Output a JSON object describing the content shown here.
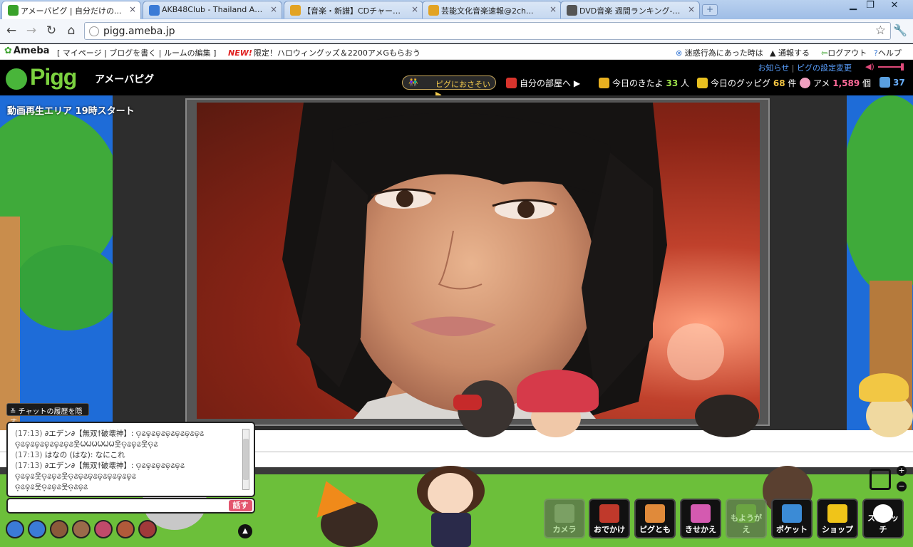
{
  "browser": {
    "tabs": [
      {
        "title": "アメーバピグ | 自分だけの...",
        "favicon_color": "#3aa22b",
        "active": true
      },
      {
        "title": "AKB48Club - Thailand AKB4...",
        "favicon_color": "#3b7bd6",
        "active": false
      },
      {
        "title": "【音楽・新譜】CDチャート速...",
        "favicon_color": "#e2a324",
        "active": false
      },
      {
        "title": "芸能文化音楽速報@2ch...",
        "favicon_color": "#e2a324",
        "active": false
      },
      {
        "title": "DVD音楽 週間ランキング-O...",
        "favicon_color": "#555555",
        "active": false
      }
    ],
    "close_glyph": "×",
    "new_tab_glyph": "+",
    "window_buttons": {
      "minimize": "▁",
      "restore": "❐",
      "close": "✕"
    },
    "toolbar": {
      "back": "←",
      "forward": "→",
      "reload": "↻",
      "home": "⌂",
      "star": "☆",
      "wrench": "🔧"
    },
    "url": "pigg.ameba.jp"
  },
  "ameba_bar": {
    "logo": "Ameba",
    "links": "[ マイページ | ブログを書く | ルームの編集 ]",
    "new_badge": "NEW!",
    "promo": "限定！ハロウィングッズ＆2200アメGもらおう",
    "report_trouble": "迷惑行為にあった時は",
    "report": "通報する",
    "logout": "ログアウト",
    "help": "ヘルプ"
  },
  "pigg_header": {
    "logo": "Pigg",
    "subtitle": "アメーバピグ",
    "notice": "お知らせ",
    "settings": "ピグの設定変更",
    "invite_button": "ピグにおさそい",
    "my_room": "自分の部屋へ",
    "visitors_label": "今日のきたよ",
    "visitors_count": "33",
    "visitors_unit": "人",
    "goods_label": "今日のグッピグ",
    "goods_count": "68",
    "goods_unit": "件",
    "ame_label": "アメ",
    "ame_count": "1,589",
    "ame_unit": "個",
    "coins": "37"
  },
  "game": {
    "area_label": "動画再生エリア 19時スタート"
  },
  "chat": {
    "hide_history": "チャットの履歴を隠す",
    "messages": [
      {
        "time": "(17:13)",
        "text": "∂エデン∂【無双†破壊神】: ଡ଼ଌଢ଼ଌଢ଼ଌଢ଼ଌଢ଼ଌଢ଼ଌଢ଼ଌ"
      },
      {
        "time": "",
        "text": "ଡ଼ଌଢ଼ଌଢ଼ଌଢ଼ଌଢ଼ଌଢ଼ଌ웃ᱦᱦᱦᱦᱦᱦ웃ଡ଼ଌଢ଼ଌ웃ଡ଼ଌ"
      },
      {
        "time": "(17:13)",
        "text": "はなの (はな): なにこれ"
      },
      {
        "time": "(17:13)",
        "text": "∂エデン∂【無双†破壊神】: ଡ଼ଌଢ଼ଌଢ଼ଌଢ଼ଌଢ଼ଌ"
      },
      {
        "time": "",
        "text": "ଡ଼ଌଢ଼ଌ웃ଡ଼ଌଢ଼ଌ웃ଡ଼ଌଢ଼ଌଢ଼ଌଢ଼ଌଢ଼ଌଢ଼ଌଢ଼ଌ"
      },
      {
        "time": "",
        "text": "ଡ଼ଌଢ଼ଌ웃ଡ଼ଌଢ଼ଌ웃ଡ଼ଌଢ଼ଌ"
      }
    ],
    "input_placeholder": "",
    "say_button": "話す",
    "up_arrow": "▲"
  },
  "menu": [
    {
      "label": "カメラ",
      "name": "camera-button",
      "color": "#888888",
      "disabled": true
    },
    {
      "label": "おでかけ",
      "name": "outing-button",
      "color": "#c0392b",
      "disabled": false
    },
    {
      "label": "ピグとも",
      "name": "pigg-friends-button",
      "color": "#e08a3a",
      "disabled": false
    },
    {
      "label": "きせかえ",
      "name": "dress-up-button",
      "color": "#d45ab0",
      "disabled": false
    },
    {
      "label": "もようがえ",
      "name": "remodel-button",
      "color": "#6b8f4a",
      "disabled": true
    },
    {
      "label": "ポケット",
      "name": "pocket-button",
      "color": "#3b8bd6",
      "disabled": false
    },
    {
      "label": "ショップ",
      "name": "shop-button",
      "color": "#f0c419",
      "disabled": false
    },
    {
      "label": "スクラッチ",
      "name": "scratch-button",
      "color": "#ffffff",
      "disabled": false
    }
  ],
  "zoom": {
    "in": "+",
    "out": "−"
  }
}
